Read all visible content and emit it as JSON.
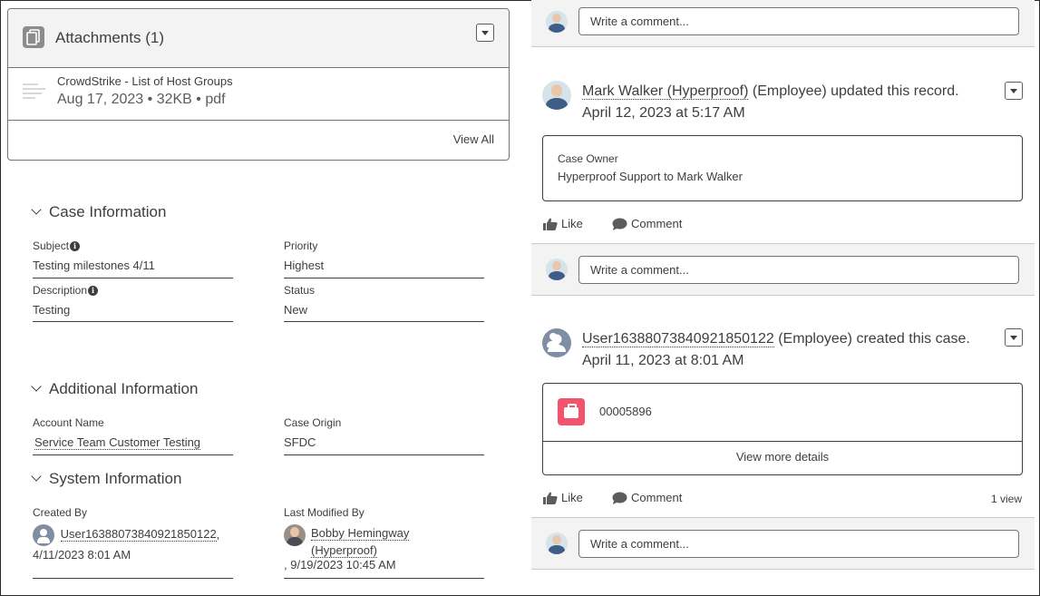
{
  "attachments": {
    "title": "Attachments (1)",
    "file_name": "CrowdStrike - List of Host Groups",
    "file_meta": "Aug 17, 2023 • 32KB • pdf",
    "view_all": "View All"
  },
  "case_information": {
    "title": "Case Information",
    "subject_label": "Subject",
    "subject_value": "Testing milestones 4/11",
    "priority_label": "Priority",
    "priority_value": "Highest",
    "description_label": "Description",
    "description_value": "Testing",
    "status_label": "Status",
    "status_value": "New"
  },
  "additional_information": {
    "title": "Additional Information",
    "account_label": "Account Name",
    "account_value": "Service Team Customer Testing",
    "origin_label": "Case Origin",
    "origin_value": "SFDC"
  },
  "system_information": {
    "title": "System Information",
    "created_label": "Created By",
    "created_user": "User16388073840921850122",
    "created_sep": ",",
    "created_date": "4/11/2023 8:01 AM",
    "modified_label": "Last Modified By",
    "modified_user_line1": "Bobby Hemingway",
    "modified_user_line2": "(Hyperproof)",
    "modified_date": ", 9/19/2023 10:45 AM"
  },
  "feed": {
    "comment_placeholder": "Write a comment...",
    "post1": {
      "author": "Mark Walker (Hyperproof)",
      "suffix": " (Employee) updated this record.",
      "date": "April 12, 2023 at 5:17 AM",
      "field_label": "Case Owner",
      "field_change": "Hyperproof Support to Mark Walker",
      "like": "Like",
      "comment": "Comment"
    },
    "post2": {
      "author": "User16388073840921850122",
      "suffix": " (Employee) created this case.",
      "date": "April 11, 2023 at 8:01 AM",
      "case_number": "00005896",
      "view_more": "View more details",
      "like": "Like",
      "comment": "Comment",
      "views": "1 view"
    }
  },
  "colors": {
    "case_icon": "#f2536d",
    "generic_avatar": "#7f8ea3",
    "strip_bg": "#f3f3f3"
  }
}
